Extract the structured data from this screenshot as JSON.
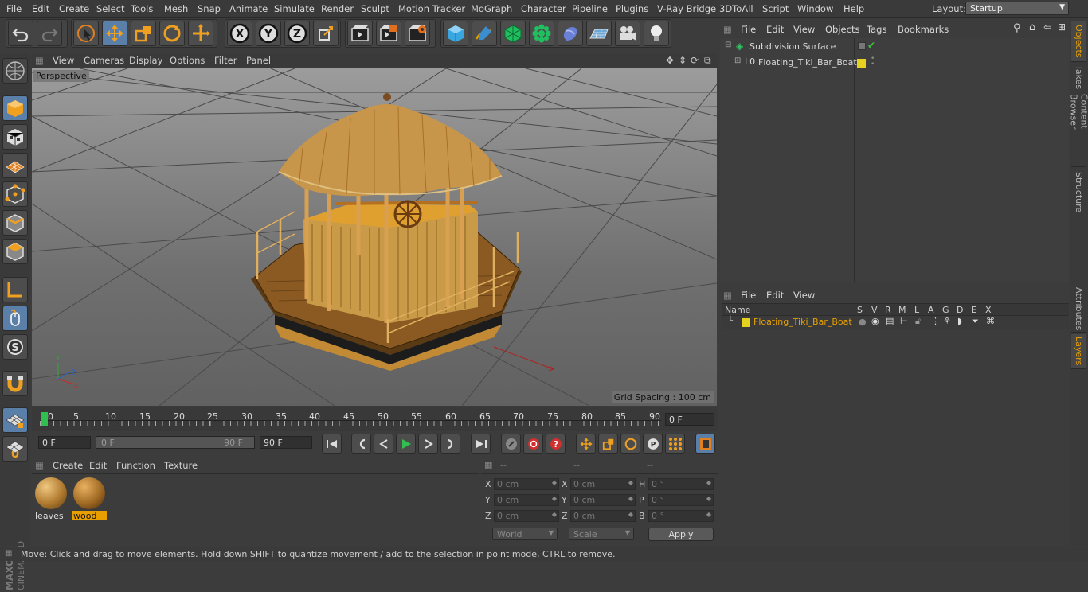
{
  "menubar": {
    "items": [
      "File",
      "Edit",
      "Create",
      "Select",
      "Tools",
      "Mesh",
      "Snap",
      "Animate",
      "Simulate",
      "Render",
      "Sculpt",
      "Motion Tracker",
      "MoGraph",
      "Character",
      "Pipeline",
      "Plugins",
      "V-Ray Bridge",
      "3DToAll",
      "Script",
      "Window",
      "Help"
    ],
    "layout_label": "Layout:",
    "layout_value": "Startup"
  },
  "toolbar": {
    "icons": [
      "undo-icon",
      "redo-icon",
      "live-selection-icon",
      "move-icon",
      "scale-icon",
      "rotate-icon",
      "transform-icon",
      "x-axis-lock-icon",
      "y-axis-lock-icon",
      "z-axis-lock-icon",
      "coordinate-system-icon",
      "render-view-icon",
      "render-picture-viewer-icon",
      "edit-render-settings-icon",
      "cube-icon",
      "pen-icon",
      "subdivision-icon",
      "array-icon",
      "deformer-icon",
      "floor-icon",
      "camera-icon",
      "light-icon"
    ]
  },
  "viewport": {
    "menu": [
      "View",
      "Cameras",
      "Display",
      "Options",
      "Filter",
      "Panel"
    ],
    "label": "Perspective",
    "grid_spacing": "Grid Spacing : 100 cm",
    "axis_y": "Y",
    "axis_x": "X",
    "axis_z": "Z"
  },
  "timeline": {
    "ticks": [
      "0",
      "5",
      "10",
      "15",
      "20",
      "25",
      "30",
      "35",
      "40",
      "45",
      "50",
      "55",
      "60",
      "65",
      "70",
      "75",
      "80",
      "85",
      "90"
    ],
    "current_frame": "0 F"
  },
  "transport": {
    "start_frame": "0 F",
    "range_start": "0 F",
    "range_end": "90 F",
    "end_frame": "90 F"
  },
  "material_manager": {
    "menu": [
      "Create",
      "Edit",
      "Function",
      "Texture"
    ],
    "materials": [
      {
        "name": "leaves",
        "selected": false
      },
      {
        "name": "wood",
        "selected": true
      }
    ]
  },
  "coordinates": {
    "headers": [
      "--",
      "--",
      "--"
    ],
    "rows": [
      {
        "l1": "X",
        "v1": "0 cm",
        "l2": "X",
        "v2": "0 cm",
        "l3": "H",
        "v3": "0 °"
      },
      {
        "l1": "Y",
        "v1": "0 cm",
        "l2": "Y",
        "v2": "0 cm",
        "l3": "P",
        "v3": "0 °"
      },
      {
        "l1": "Z",
        "v1": "0 cm",
        "l2": "Z",
        "v2": "0 cm",
        "l3": "B",
        "v3": "0 °"
      }
    ],
    "mode": "World",
    "scale_mode": "Scale",
    "apply_label": "Apply"
  },
  "object_manager": {
    "menu": [
      "File",
      "Edit",
      "View",
      "Objects",
      "Tags",
      "Bookmarks"
    ],
    "objects": [
      {
        "name": "Subdivision Surface",
        "level": 0
      },
      {
        "name": "Floating_Tiki_Bar_Boat",
        "level": 1
      }
    ],
    "layer_color": "#e6d21e"
  },
  "layer_manager": {
    "menu": [
      "File",
      "Edit",
      "View"
    ],
    "columns": [
      "Name",
      "S",
      "V",
      "R",
      "M",
      "L",
      "A",
      "G",
      "D",
      "E",
      "X"
    ],
    "layers": [
      {
        "name": "Floating_Tiki_Bar_Boat",
        "color": "#e6d21e"
      }
    ]
  },
  "side_tabs": [
    "Objects",
    "Takes",
    "Content Browser",
    "Structure",
    "Attributes",
    "Layers"
  ],
  "statusbar": {
    "text": "Move: Click and drag to move elements. Hold down SHIFT to quantize movement / add to the selection in point mode, CTRL to remove."
  },
  "brand": {
    "line1": "MAXON",
    "line2": "CINEMA 4D"
  },
  "colors": {
    "accent": "#5a7fa8",
    "highlight": "#e8a000",
    "layer": "#e6d21e"
  }
}
